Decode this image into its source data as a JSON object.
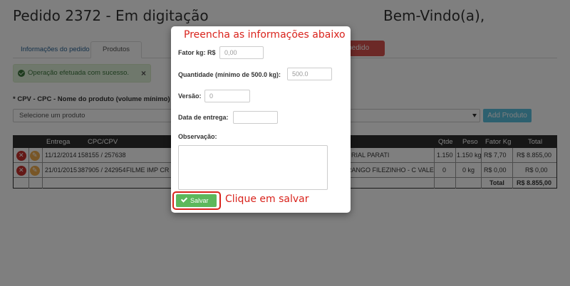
{
  "header": {
    "title": "Pedido 2372 - Em digitação",
    "welcome": "Bem-Vindo(a),"
  },
  "tabs": [
    {
      "label": "Informações do pedido"
    },
    {
      "label": "Produtos"
    }
  ],
  "red_button": {
    "label": "r pedido"
  },
  "alert": {
    "message": "Operação efetuada com sucesso.",
    "close": "×"
  },
  "product_select": {
    "label": "* CPV - CPC - Nome do produto (volume mínimo)",
    "selected": "Selecione um produto"
  },
  "add_button": {
    "label": "Add Produto"
  },
  "table": {
    "headers": {
      "entrega": "Entrega",
      "cpc": "CPC/CPV",
      "qtde": "Qtde",
      "peso": "Peso",
      "fator": "Fator Kg",
      "total": "Total"
    },
    "rows": [
      {
        "entrega": "11/12/2014",
        "cpc": "158155 / 257638",
        "produto": "",
        "cliente": "RIAL PARATI",
        "qtde": "1.150",
        "peso": "1.150 kg",
        "fator": "R$ 7,70",
        "total": "R$ 8.855,00"
      },
      {
        "entrega": "21/01/2015",
        "cpc": "387905 / 242954",
        "produto": "FILME IMP CR",
        "cliente": "RANGO FILEZINHO - C VALE",
        "qtde": "0",
        "peso": "0 kg",
        "fator": "R$ 0,00",
        "total": "R$ 0,00"
      }
    ],
    "footer": {
      "label": "Total",
      "value": "R$ 8.855,00"
    }
  },
  "modal": {
    "heading": "Preencha as informações abaixo",
    "fator_label": "Fator kg: R$",
    "fator_placeholder": "0,00",
    "quantidade_label": "Quantidade (mínimo de 500.0 kg):",
    "quantidade_placeholder": "500.0",
    "versao_label": "Versão:",
    "versao_placeholder": "0",
    "data_label": "Data de entrega:",
    "observacao_label": "Observação:",
    "save_label": "Salvar"
  },
  "annotation": {
    "click_note": "Clique em salvar"
  },
  "colors": {
    "accent_red": "#d9231c",
    "save_green": "#5cb85c",
    "info_blue": "#5bc0de"
  }
}
